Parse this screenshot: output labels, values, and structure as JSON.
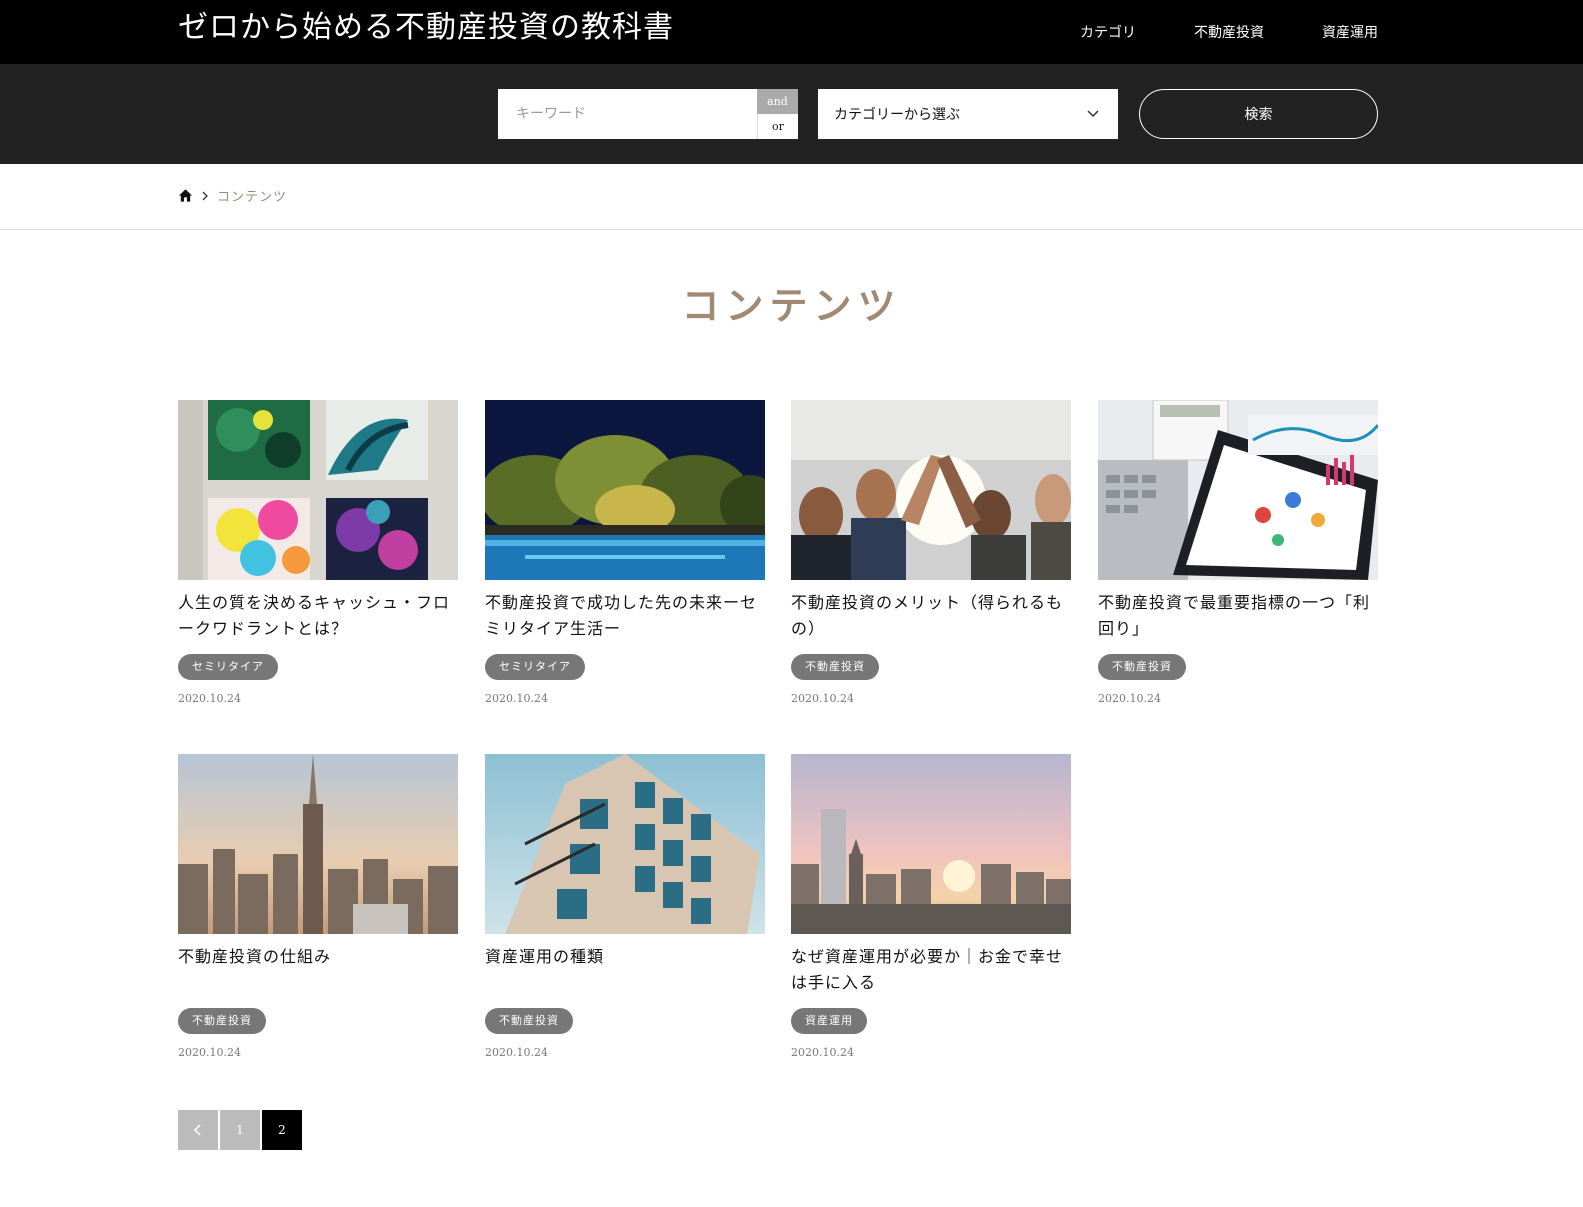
{
  "header": {
    "site_title": "ゼロから始める不動産投資の教科書",
    "nav": [
      "カテゴリ",
      "不動産投資",
      "資産運用"
    ]
  },
  "search": {
    "keyword_placeholder": "キーワード",
    "and_label": "and",
    "or_label": "or",
    "category_label": "カテゴリーから選ぶ",
    "button_label": "検索"
  },
  "breadcrumb": {
    "current": "コンテンツ"
  },
  "page_title": "コンテンツ",
  "posts": [
    {
      "title": "人生の質を決めるキャッシュ・フロークワドラントとは？",
      "tag": "セミリタイア",
      "date": "2020.10.24",
      "image": "abstract-paintings"
    },
    {
      "title": "不動産投資で成功した先の未来ーセミリタイア生活ー",
      "tag": "セミリタイア",
      "date": "2020.10.24",
      "image": "night-pool-resort"
    },
    {
      "title": "不動産投資のメリット（得られるもの）",
      "tag": "不動産投資",
      "date": "2020.10.24",
      "image": "team-high-five"
    },
    {
      "title": "不動産投資で最重要指標の一つ「利回り」",
      "tag": "不動産投資",
      "date": "2020.10.24",
      "image": "tablet-charts"
    },
    {
      "title": "不動産投資の仕組み",
      "tag": "不動産投資",
      "date": "2020.10.24",
      "image": "city-skyline"
    },
    {
      "title": "資産運用の種類",
      "tag": "不動産投資",
      "date": "2020.10.24",
      "image": "apartment-building"
    },
    {
      "title": "なぜ資産運用が必要か｜お金で幸せは手に入る",
      "tag": "資産運用",
      "date": "2020.10.24",
      "image": "sunset-city"
    }
  ],
  "pagination": {
    "prev_icon": "chevron-left-icon",
    "pages": [
      "1",
      "2"
    ],
    "current": "2"
  }
}
